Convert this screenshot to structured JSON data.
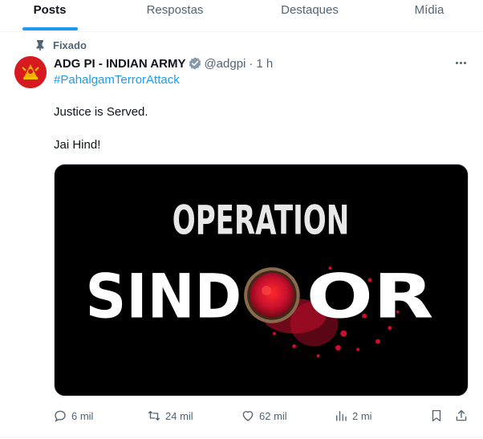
{
  "tabs": [
    {
      "label": "Posts",
      "active": true
    },
    {
      "label": "Respostas"
    },
    {
      "label": "Destaques"
    },
    {
      "label": "Mídia"
    }
  ],
  "colors": {
    "accent": "#1d9bf0",
    "text": "#0f1419",
    "muted": "#536471",
    "sindoor_red": "#c8102e"
  },
  "post": {
    "pinned_label": "Fixado",
    "display_name": "ADG PI - INDIAN ARMY",
    "handle": "@adgpi",
    "separator": "·",
    "time": "1 h",
    "hashtag": "#PahalgamTerrorAttack",
    "text_line1": "Justice is Served.",
    "text_line2": "Jai Hind!",
    "media": {
      "line1": "OPERATION",
      "line2_left": "SIND",
      "line2_right": "OR"
    },
    "actions": {
      "replies": "6 mil",
      "reposts": "24 mil",
      "likes": "62 mil",
      "views": "2 mi"
    }
  }
}
